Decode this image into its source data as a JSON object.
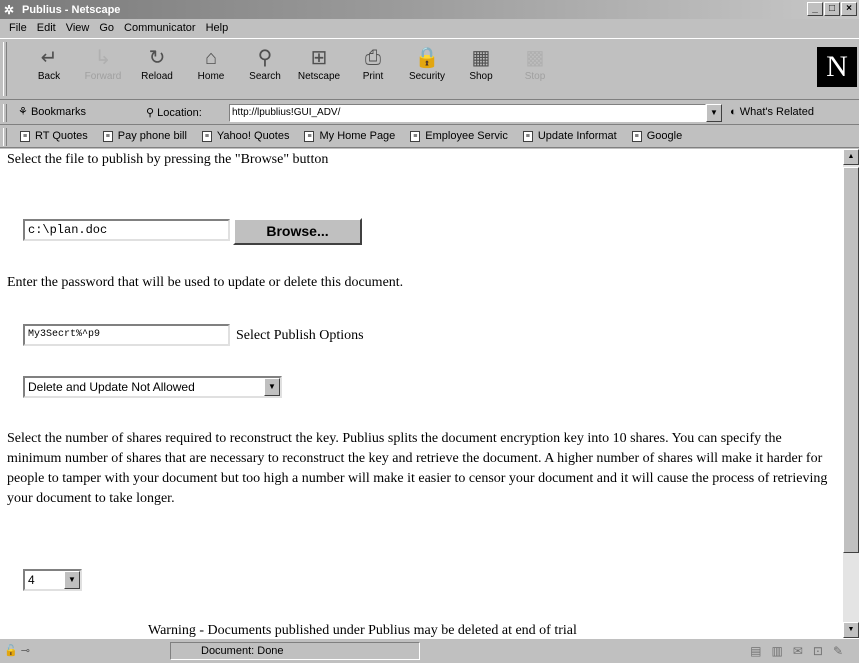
{
  "window": {
    "title": "Publius - Netscape",
    "controls": [
      "_",
      "□",
      "×"
    ]
  },
  "menu": [
    "File",
    "Edit",
    "View",
    "Go",
    "Communicator",
    "Help"
  ],
  "toolbar": {
    "buttons": [
      {
        "label": "Back",
        "icon": "back-arrow-icon",
        "glyph": "↵",
        "disabled": false
      },
      {
        "label": "Forward",
        "icon": "forward-arrow-icon",
        "glyph": "↳",
        "disabled": true
      },
      {
        "label": "Reload",
        "icon": "reload-icon",
        "glyph": "↻",
        "disabled": false
      },
      {
        "label": "Home",
        "icon": "home-icon",
        "glyph": "⌂",
        "disabled": false
      },
      {
        "label": "Search",
        "icon": "search-icon",
        "glyph": "⚲",
        "disabled": false
      },
      {
        "label": "Netscape",
        "icon": "netscape-icon",
        "glyph": "⊞",
        "disabled": false
      },
      {
        "label": "Print",
        "icon": "print-icon",
        "glyph": "⎙",
        "disabled": false
      },
      {
        "label": "Security",
        "icon": "lock-icon",
        "glyph": "🔒",
        "disabled": false
      },
      {
        "label": "Shop",
        "icon": "shop-icon",
        "glyph": "▦",
        "disabled": false
      },
      {
        "label": "Stop",
        "icon": "stop-icon",
        "glyph": "▩",
        "disabled": true
      }
    ],
    "logo": "N"
  },
  "location": {
    "bookmarks_label": "Bookmarks",
    "location_label": "Location:",
    "url": "http://lpublius!GUI_ADV/",
    "whats_related": "What's Related"
  },
  "personal_toolbar": [
    "RT Quotes",
    "Pay phone bill",
    "Yahoo! Quotes",
    "My Home Page",
    "Employee Servic",
    "Update Informat",
    "Google"
  ],
  "page": {
    "file_prompt": "Select the file to publish by pressing the \"Browse\" button",
    "file_value": "c:\\plan.doc",
    "browse_label": "Browse...",
    "password_prompt": "Enter the password that will be used to update or delete this document.",
    "password_value": "My3Secrt%^p9",
    "publish_options_label": "Select Publish Options",
    "publish_option_selected": "Delete and Update Not Allowed",
    "shares_paragraph": "Select the number of shares required to reconstruct the key. Publius splits the document encryption key into 10 shares. You can specify the minimum number of shares that are necessary to reconstruct the key and retrieve the document. A higher number of shares will make it harder for people to tamper with your document but too high a number will make it easier to censor your document and it will cause the process of retrieving your document to take longer.",
    "shares_selected": "4",
    "warning": "Warning - Documents published under Publius may be deleted at end of trial"
  },
  "status": {
    "text": "Document: Done"
  }
}
